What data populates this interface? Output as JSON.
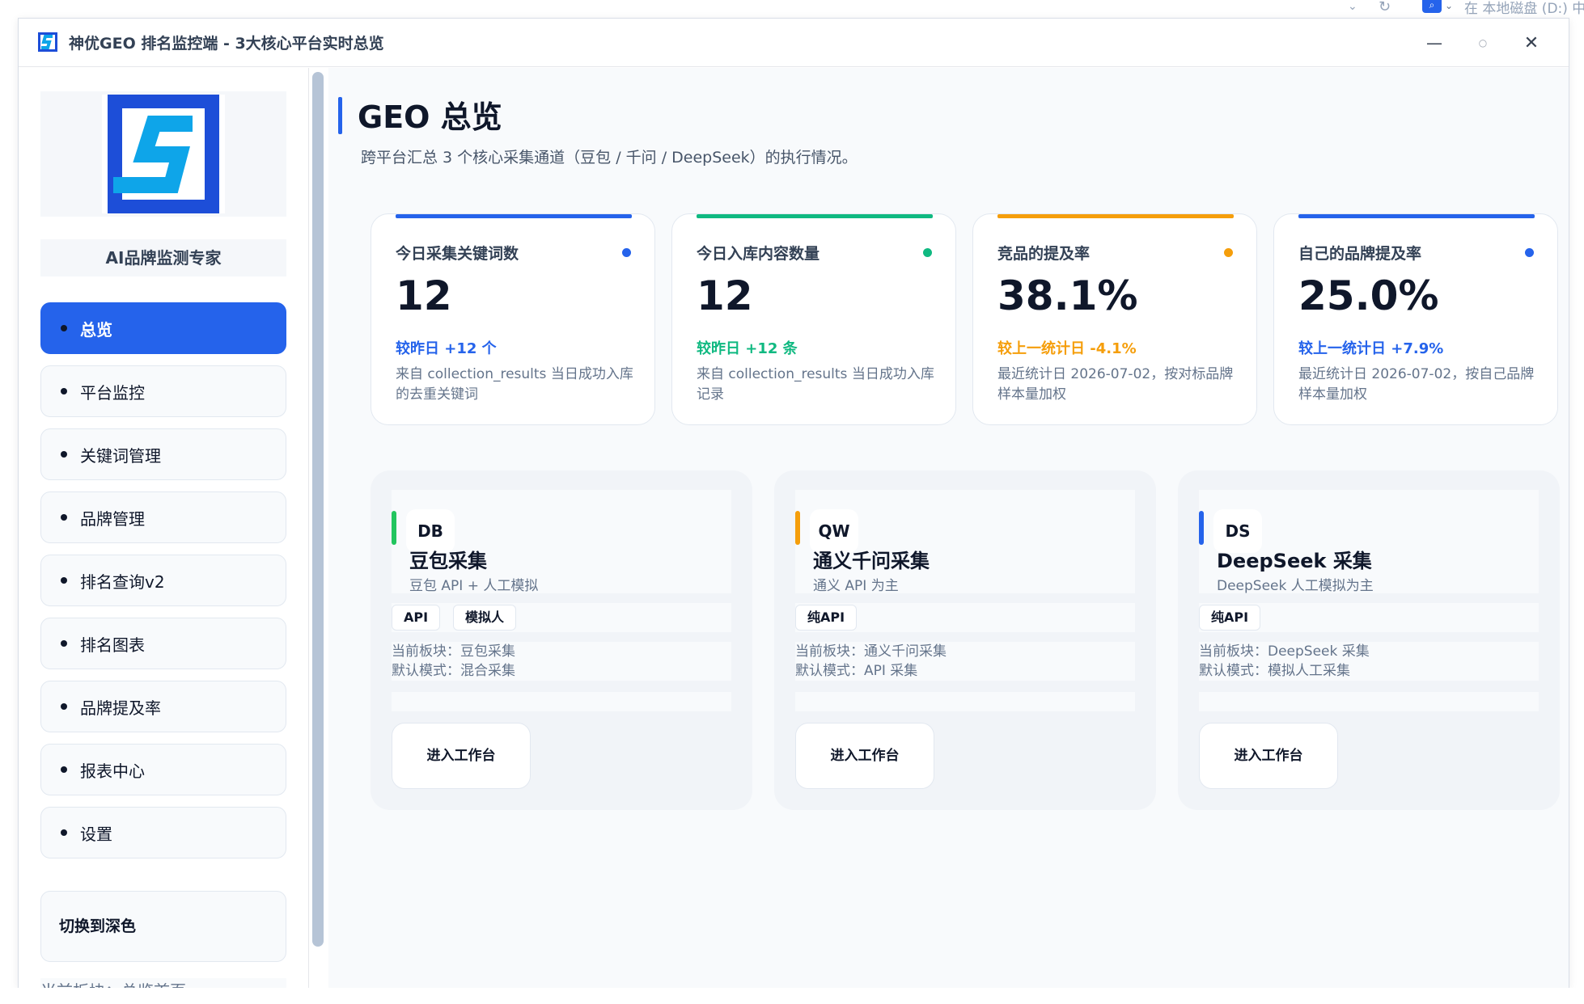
{
  "browser": {
    "tail_text": "在 本地磁盘 (D:) 中"
  },
  "window": {
    "title": "神优GEO 排名监控端 - 3大核心平台实时总览"
  },
  "sidebar": {
    "slogan": "AI品牌监测专家",
    "items": [
      {
        "label": "总览",
        "active": true
      },
      {
        "label": "平台监控"
      },
      {
        "label": "关键词管理"
      },
      {
        "label": "品牌管理"
      },
      {
        "label": "排名查询v2"
      },
      {
        "label": "排名图表"
      },
      {
        "label": "品牌提及率"
      },
      {
        "label": "报表中心"
      },
      {
        "label": "设置"
      }
    ],
    "theme_button": "切换到深色",
    "current_block": "当前板块：总览首页"
  },
  "main": {
    "title": "GEO 总览",
    "subtitle": "跨平台汇总 3 个核心采集通道（豆包 / 千问 / DeepSeek）的执行情况。",
    "stats": [
      {
        "label": "今日采集关键词数",
        "value": "12",
        "delta": "较昨日 +12 个",
        "desc": "来自 collection_results 当日成功入库的去重关键词",
        "color": "#2563eb"
      },
      {
        "label": "今日入库内容数量",
        "value": "12",
        "delta": "较昨日 +12 条",
        "desc": "来自 collection_results 当日成功入库记录",
        "color": "#10b981"
      },
      {
        "label": "竞品的提及率",
        "value": "38.1%",
        "delta": "较上一统计日 -4.1%",
        "desc": "最近统计日 2026-07-02，按对标品牌样本量加权",
        "color": "#f59e0b"
      },
      {
        "label": "自己的品牌提及率",
        "value": "25.0%",
        "delta": "较上一统计日 +7.9%",
        "desc": "最近统计日 2026-07-02，按自己品牌样本量加权",
        "color": "#2563eb"
      }
    ],
    "platforms": [
      {
        "badge": "DB",
        "name": "豆包采集",
        "sub": "豆包 API + 人工模拟",
        "tags": [
          "API",
          "模拟人"
        ],
        "current": "当前板块：豆包采集",
        "mode": "默认模式：混合采集",
        "button": "进入工作台",
        "accent": "#22c55e"
      },
      {
        "badge": "QW",
        "name": "通义千问采集",
        "sub": "通义 API 为主",
        "tags": [
          "纯API"
        ],
        "current": "当前板块：通义千问采集",
        "mode": "默认模式：API 采集",
        "button": "进入工作台",
        "accent": "#f59e0b"
      },
      {
        "badge": "DS",
        "name": "DeepSeek 采集",
        "sub": "DeepSeek 人工模拟为主",
        "tags": [
          "纯API"
        ],
        "current": "当前板块：DeepSeek 采集",
        "mode": "默认模式：模拟人工采集",
        "button": "进入工作台",
        "accent": "#2563eb"
      }
    ]
  },
  "colors": {
    "primary": "#2563eb",
    "logo_blue": "#1d4ed8",
    "logo_cyan": "#0ea5e9"
  }
}
